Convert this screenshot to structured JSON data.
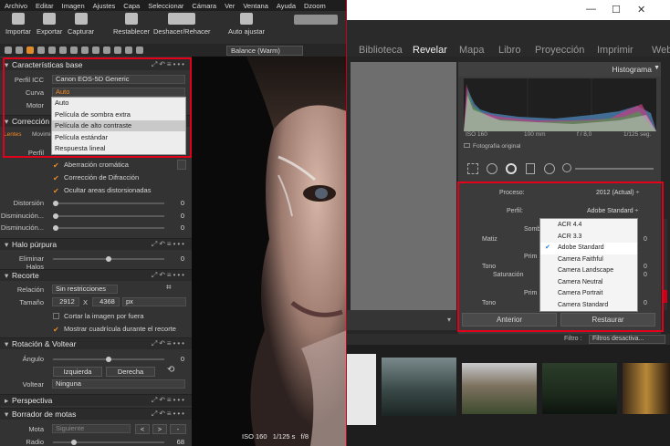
{
  "left_app": {
    "menu": [
      "Archivo",
      "Editar",
      "Imagen",
      "Ajustes",
      "Capa",
      "Seleccionar",
      "Cámara",
      "Ver",
      "Ventana",
      "Ayuda",
      "Dzoom"
    ],
    "toolbar": {
      "importar": "Importar",
      "exportar": "Exportar",
      "capturar": "Capturar",
      "restablecer": "Restablecer",
      "deshacer_rehacer": "Deshacer/Rehacer",
      "auto_ajustar": "Auto ajustar"
    },
    "balance_select": "Balance (Warm)",
    "caracteristicas": {
      "title": "Características base",
      "perfil_icc_label": "Perfil ICC",
      "perfil_icc_value": "Canon EOS-5D Generic",
      "curva_label": "Curva",
      "curva_value": "Auto",
      "motor_label": "Motor",
      "dropdown_options": [
        "Auto",
        "Película de sombra extra",
        "Película de alto contraste",
        "Película estándar",
        "Respuesta lineal"
      ]
    },
    "correccion": {
      "title": "Corrección d",
      "tab_lentes": "Lentes",
      "tab_movimiento": "Movimie",
      "perfil_label": "Perfil",
      "aberracion": "Aberración cromática",
      "difraccion": "Corrección de Difracción",
      "ocultar": "Ocultar areas distorsionadas",
      "distorsion_label": "Distorsión",
      "distorsion_value": "0",
      "dism1_label": "Disminución...",
      "dism1_value": "0",
      "dism2_label": "Disminución...",
      "dism2_value": "0"
    },
    "halo": {
      "title": "Halo púrpura",
      "eliminar_label": "Eliminar Halos",
      "eliminar_value": "0"
    },
    "recorte": {
      "title": "Recorte",
      "relacion_label": "Relación",
      "relacion_value": "Sin restricciones",
      "tamano_label": "Tamaño",
      "width": "2912",
      "x": "X",
      "height": "4368",
      "unit": "px",
      "cortar": "Cortar la imagen por fuera",
      "mostrar": "Mostrar cuadrícula durante el recorte"
    },
    "rotacion": {
      "title": "Rotación & Voltear",
      "angulo_label": "Ángulo",
      "angulo_value": "0",
      "izquierda": "Izquierda",
      "derecha": "Derecha",
      "voltear_label": "Voltear",
      "voltear_value": "Ninguna"
    },
    "perspectiva": {
      "title": "Perspectiva"
    },
    "borrador": {
      "title": "Borrador de motas",
      "mota_label": "Mota",
      "mota_value": "Siguiente",
      "radio_label": "Radio",
      "radio_value": "68"
    },
    "status": {
      "iso": "ISO 160",
      "shutter": "1/125 s",
      "aperture": "f/8"
    }
  },
  "right_app": {
    "modules": [
      "Biblioteca",
      "Revelar",
      "Mapa",
      "Libro",
      "Proyección",
      "Imprimir",
      "Web"
    ],
    "active_module": "Revelar",
    "histograma": "Histograma",
    "hist_info": [
      "ISO 160",
      "100 mm",
      "f / 8,0",
      "1/125 seg."
    ],
    "foto_original": "Fotografía original",
    "proceso_label": "Proceso:",
    "proceso_value": "2012 (Actual) ÷",
    "perfil_label": "Perfil:",
    "perfil_value": "Adobe Standard ÷",
    "partial_labels": {
      "somb": "Somb",
      "matiz": "Matiz",
      "prim1": "Prim",
      "tono1": "Tono",
      "saturacion": "Saturación",
      "prim2": "Prim",
      "tono2": "Tono",
      "zero1": "0",
      "zero2": "0",
      "zero3": "0",
      "zero4": "0"
    },
    "perfil_options": [
      "ACR 4.4",
      "ACR 3.3",
      "Adobe Standard",
      "Camera Faithful",
      "Camera Landscape",
      "Camera Neutral",
      "Camera Portrait",
      "Camera Standard"
    ],
    "perfil_selected": "Adobe Standard",
    "anterior": "Anterior",
    "restaurar": "Restaurar",
    "filtro_label": "Filtro :",
    "filtro_value": "Filtros desactiva..."
  },
  "colors": {
    "highlight_red": "#e2001a",
    "accent_orange": "#f08a24",
    "check_blue": "#1f7fd6"
  }
}
